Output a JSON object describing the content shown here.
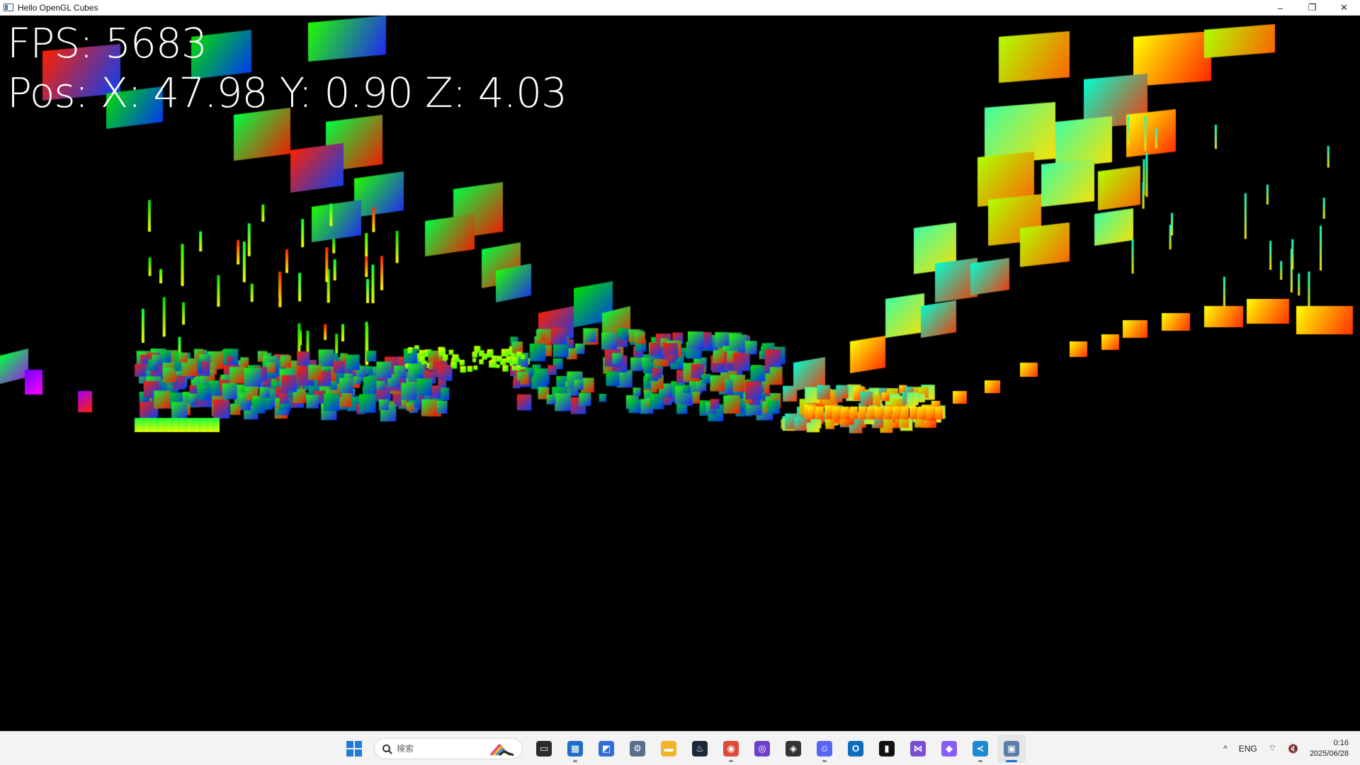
{
  "window": {
    "title": "Hello OpenGL Cubes",
    "controls": {
      "minimize": "–",
      "restore": "❐",
      "close": "✕"
    }
  },
  "hud": {
    "fps": "FPS: 5683",
    "position": "Pos: X: 47.98 Y: 0.90 Z: 4.03"
  },
  "taskbar": {
    "search_placeholder": "検索",
    "apps": [
      {
        "name": "task-view",
        "color": "#2b2b2b",
        "symbol": "▭"
      },
      {
        "name": "photos",
        "color": "#1e6fc4",
        "symbol": "▦",
        "running": true
      },
      {
        "name": "tool-app",
        "color": "#2f6fd6",
        "symbol": "◩"
      },
      {
        "name": "settings",
        "color": "#5b6f8a",
        "symbol": "⚙"
      },
      {
        "name": "file-explorer",
        "color": "#f0b429",
        "symbol": "▬"
      },
      {
        "name": "steam",
        "color": "#1b2838",
        "symbol": "♨"
      },
      {
        "name": "chrome",
        "color": "#dd4b39",
        "symbol": "◉",
        "running": true
      },
      {
        "name": "github-desktop",
        "color": "#6e40c9",
        "symbol": "◎"
      },
      {
        "name": "unity-hub",
        "color": "#333333",
        "symbol": "◈"
      },
      {
        "name": "discord",
        "color": "#5865f2",
        "symbol": "☺",
        "running": true
      },
      {
        "name": "outlook",
        "color": "#0f6cbd",
        "symbol": "O"
      },
      {
        "name": "terminal",
        "color": "#111111",
        "symbol": "▮"
      },
      {
        "name": "visual-studio",
        "color": "#7a4fcf",
        "symbol": "⋈"
      },
      {
        "name": "rider-like",
        "color": "#8a5cf6",
        "symbol": "◆"
      },
      {
        "name": "vscode",
        "color": "#1f8ad2",
        "symbol": "≺",
        "running": true
      },
      {
        "name": "opengl-cubes",
        "color": "#5a7ea6",
        "symbol": "▣",
        "active": true
      }
    ],
    "tray": {
      "chevron": "^",
      "language": "ENG",
      "wifi": "⌔",
      "volume": "🔇",
      "time": "0:16",
      "date": "2025/06/28"
    }
  }
}
